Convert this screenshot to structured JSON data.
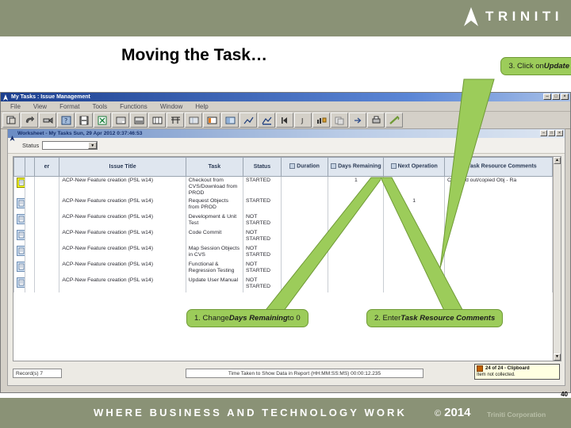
{
  "brand": {
    "name": "TRINITI",
    "tagline": "WHERE BUSINESS AND TECHNOLOGY WORK",
    "copyright_mark": "©",
    "copyright_year": "2014",
    "corporation": "Triniti Corporation",
    "bar_color": "#8a9276"
  },
  "slide": {
    "title": "Moving the Task…",
    "page_number": "40"
  },
  "callouts": [
    {
      "id": "update",
      "prefix": "3. Click on ",
      "emphasis": "Update"
    },
    {
      "id": "days",
      "prefix": "1. Change ",
      "emphasis": "Days Remaining",
      "suffix": " to 0"
    },
    {
      "id": "comments",
      "prefix": "2. Enter ",
      "emphasis": "Task Resource Comments"
    }
  ],
  "window": {
    "title": "My Tasks : Issue Management",
    "icon": "app-icon",
    "controls": [
      {
        "name": "minimize",
        "glyph": "–"
      },
      {
        "name": "maximize",
        "glyph": "□"
      },
      {
        "name": "close",
        "glyph": "×"
      }
    ],
    "menu": [
      "File",
      "View",
      "Format",
      "Tools",
      "Functions",
      "Window",
      "Help"
    ],
    "toolbar": [
      "new-icon",
      "undo-icon",
      "edit-icon",
      "query-icon",
      "save-icon",
      "export-excel-icon",
      "report-icon",
      "picture-icon",
      "columns-icon",
      "filter-icon",
      "table-icon",
      "layout-icon",
      "properties-icon",
      "chart-icon",
      "graph-icon",
      "first-record-icon",
      "next-record-icon",
      "sort-icon",
      "copy-icon",
      "refresh-icon",
      "print-icon",
      "update-icon"
    ]
  },
  "worksheet": {
    "title": "Worksheet - My Tasks Sun, 29 Apr 2012 0:37:46:53",
    "icon": "worksheet-icon",
    "controls": [
      {
        "name": "minimize",
        "glyph": "–"
      },
      {
        "name": "maximize",
        "glyph": "□"
      },
      {
        "name": "close",
        "glyph": "×"
      }
    ],
    "filter": {
      "label": "Status",
      "value": "",
      "dropdown_glyph": "▼"
    }
  },
  "grid": {
    "columns": [
      {
        "key": "sel",
        "label": "",
        "icon": "select-icon"
      },
      {
        "key": "flag",
        "label": "",
        "icon": ""
      },
      {
        "key": "num",
        "label": "er",
        "icon": ""
      },
      {
        "key": "issue",
        "label": "Issue Title",
        "icon": ""
      },
      {
        "key": "task",
        "label": "Task",
        "icon": ""
      },
      {
        "key": "status",
        "label": "Status",
        "icon": ""
      },
      {
        "key": "dur",
        "label": "Duration",
        "icon": "sort-col-icon"
      },
      {
        "key": "days",
        "label": "Days Remaining",
        "icon": "sort-col-icon"
      },
      {
        "key": "next",
        "label": "Next Operation",
        "icon": "sort-col-icon"
      },
      {
        "key": "comm",
        "label": "Task Resource Comments",
        "icon": "sort-col-icon"
      }
    ],
    "rows": [
      {
        "selected": true,
        "issue": "ACP-New Feature creation (PSL w14)",
        "task": "Checkout from CVS/Download from PROD",
        "status": "STARTED",
        "dur": "",
        "days": "1",
        "next": "",
        "comm": "Checked out/copied Obj - Ra"
      },
      {
        "selected": false,
        "issue": "ACP-New Feature creation (PSL w14)",
        "task": "Request Objects from PROD",
        "status": "STARTED",
        "dur": "",
        "days": "",
        "next": "1",
        "comm": ""
      },
      {
        "selected": false,
        "issue": "ACP-New Feature creation (PSL w14)",
        "task": "Development & Unit Test",
        "status": "NOT STARTED",
        "dur": "",
        "days": "",
        "next": "",
        "comm": ""
      },
      {
        "selected": false,
        "issue": "ACP-New Feature creation (PSL w14)",
        "task": "Code Commit",
        "status": "NOT STARTED",
        "dur": "",
        "days": "",
        "next": "",
        "comm": ""
      },
      {
        "selected": false,
        "issue": "ACP-New Feature creation (PSL w14)",
        "task": "Map Session Objects in CVS",
        "status": "NOT STARTED",
        "dur": "",
        "days": "",
        "next": "",
        "comm": ""
      },
      {
        "selected": false,
        "issue": "ACP-New Feature creation (PSL w14)",
        "task": "Functional & Regression Testing",
        "status": "NOT STARTED",
        "dur": "",
        "days": "",
        "next": "",
        "comm": ""
      },
      {
        "selected": false,
        "issue": "ACP-New Feature creation (PSL w14)",
        "task": "Update User Manual",
        "status": "NOT STARTED",
        "dur": "",
        "days": "",
        "next": "",
        "comm": ""
      }
    ]
  },
  "status_bar": {
    "records": "Record(s) 7",
    "time_taken": "Time Taken to Show Data in Report (HH:MM:SS:MS) 00:00:12.235",
    "clipboard_line1": "24 of 24 - Clipboard",
    "clipboard_line2": "Item not collected."
  }
}
